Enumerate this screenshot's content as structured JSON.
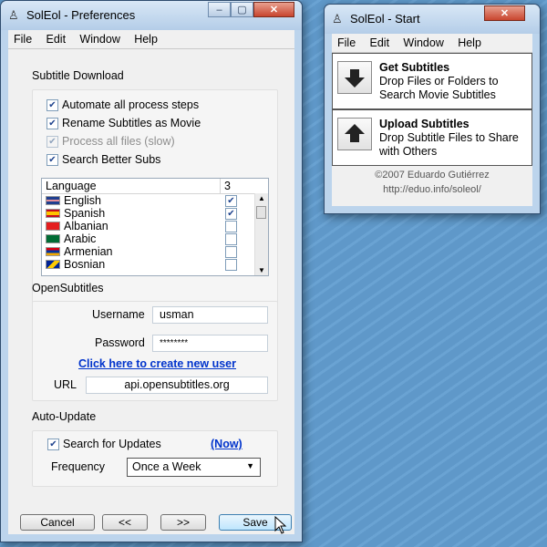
{
  "prefs": {
    "title": "SolEol - Preferences",
    "menu": [
      "File",
      "Edit",
      "Window",
      "Help"
    ],
    "subtitle_download": {
      "heading": "Subtitle Download",
      "options": [
        {
          "label": "Automate all process steps",
          "checked": true,
          "disabled": false
        },
        {
          "label": "Rename Subtitles as Movie",
          "checked": true,
          "disabled": false
        },
        {
          "label": "Process all files (slow)",
          "checked": true,
          "disabled": true
        },
        {
          "label": "Search Better Subs",
          "checked": true,
          "disabled": false
        }
      ],
      "language_list": {
        "header_language": "Language",
        "header_count": "3",
        "rows": [
          {
            "name": "English",
            "checked": true,
            "flag": "uk-flag-icon",
            "colors": [
              "#1f3f8f",
              "#ffffff",
              "#cc2233"
            ]
          },
          {
            "name": "Spanish",
            "checked": true,
            "flag": "spain-flag-icon",
            "colors": [
              "#c60b1e",
              "#ffc400",
              "#c60b1e"
            ]
          },
          {
            "name": "Albanian",
            "checked": false,
            "flag": "albania-flag-icon",
            "colors": [
              "#e41e20",
              "#e41e20",
              "#e41e20"
            ]
          },
          {
            "name": "Arabic",
            "checked": false,
            "flag": "saudi-flag-icon",
            "colors": [
              "#006c35",
              "#006c35",
              "#006c35"
            ]
          },
          {
            "name": "Armenian",
            "checked": false,
            "flag": "armenia-flag-icon",
            "colors": [
              "#d90012",
              "#0033a0",
              "#f2a800"
            ]
          },
          {
            "name": "Bosnian",
            "checked": false,
            "flag": "bosnia-flag-icon",
            "colors": [
              "#002395",
              "#fecb00",
              "#002395"
            ]
          }
        ]
      }
    },
    "opensubtitles": {
      "heading": "OpenSubtitles",
      "username_label": "Username",
      "username_value": "usman",
      "password_label": "Password",
      "password_value": "********",
      "create_user_link": "Click here to create new user",
      "url_label": "URL",
      "url_value": "api.opensubtitles.org"
    },
    "auto_update": {
      "heading": "Auto-Update",
      "search_label": "Search for Updates",
      "search_checked": true,
      "now_link": "(Now)",
      "frequency_label": "Frequency",
      "frequency_value": "Once a Week"
    },
    "buttons": {
      "cancel": "Cancel",
      "prev": "<<",
      "next": ">>",
      "save": "Save"
    }
  },
  "start": {
    "title": "SolEol - Start",
    "menu": [
      "File",
      "Edit",
      "Window",
      "Help"
    ],
    "get": {
      "title": "Get Subtitles",
      "desc_line1": "Drop Files or Folders to",
      "desc_line2": "Search Movie Subtitles"
    },
    "upload": {
      "title": "Upload Subtitles",
      "desc_line1": "Drop Subtitle Files to Share",
      "desc_line2": "with Others"
    },
    "credits_line1": "©2007 Eduardo Gutiérrez",
    "credits_line2": "http://eduo.info/soleol/"
  }
}
